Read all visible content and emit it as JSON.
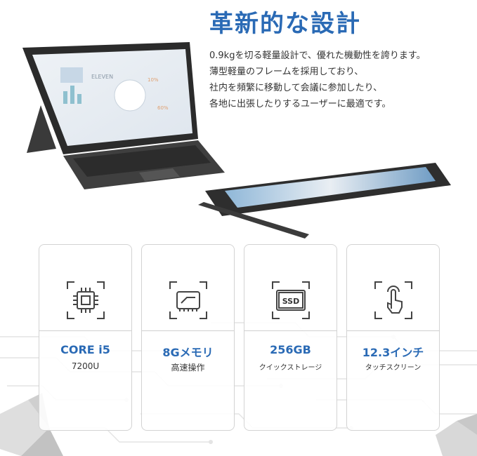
{
  "heading": "革新的な設計",
  "description": [
    "0.9kgを切る軽量設計で、優れた機動性を誇ります。",
    "薄型軽量のフレームを採用しており、",
    "社内を頻繁に移動して会議に参加したり、",
    "各地に出張したりするユーザーに最適です。"
  ],
  "specs": [
    {
      "title": "CORE i5",
      "subtitle": "7200U",
      "icon": "cpu-chip-icon"
    },
    {
      "title": "8Gメモリ",
      "subtitle": "高速操作",
      "icon": "memory-module-icon"
    },
    {
      "title": "256GB",
      "subtitle": "クイックストレージ",
      "icon": "ssd-icon"
    },
    {
      "title": "12.3インチ",
      "subtitle": "タッチスクリーン",
      "icon": "touch-hand-icon"
    }
  ],
  "ssd_label": "SSD",
  "colors": {
    "accent": "#2a6ab5",
    "text": "#333333",
    "border": "#d3d3d3"
  }
}
